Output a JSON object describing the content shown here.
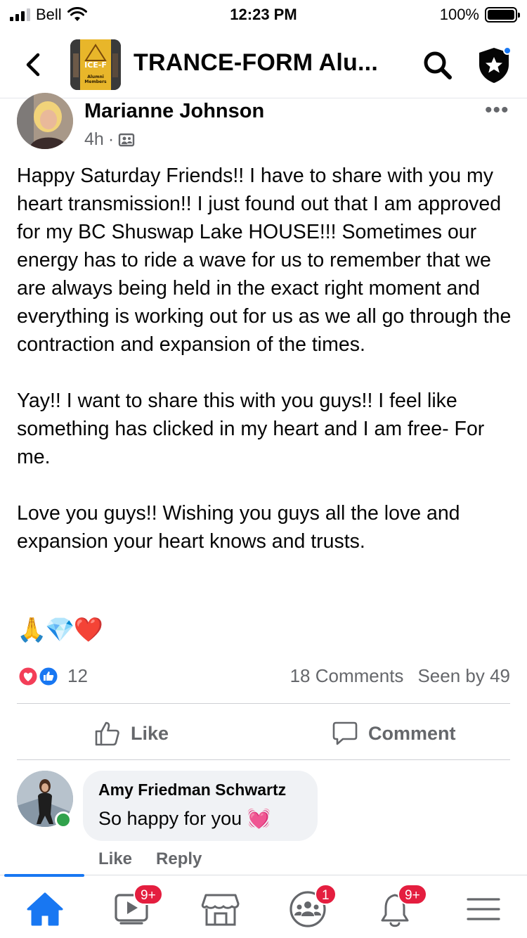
{
  "status_bar": {
    "carrier": "Bell",
    "time": "12:23 PM",
    "battery": "100%"
  },
  "header": {
    "title": "TRANCE-FORM Alu...",
    "thumb_text_top": "ICE-F",
    "thumb_text_bottom": "Alumni Members"
  },
  "post": {
    "author": "Marianne Johnson",
    "time": "4h",
    "separator": "·",
    "more": "•••",
    "body": "Happy Saturday Friends!! I have to share with you my heart transmission!! I just found out that I am approved for my BC Shuswap Lake HOUSE!!! Sometimes our energy has to ride a wave for us to remember that we are always being held in the exact right moment and everything is working out for us as we all go through the contraction and expansion of the times.\n\nYay!! I want to share this with you guys!! I feel like something has clicked in my heart and I am free- For me.\n\nLove you guys!! Wishing you guys all the love and expansion your heart knows and trusts.",
    "emojis": "🙏💎❤️",
    "reaction_count": "12",
    "comments": "18 Comments",
    "seen_by": "Seen by 49"
  },
  "actions": {
    "like": "Like",
    "comment": "Comment"
  },
  "comment": {
    "author": "Amy Friedman Schwartz",
    "text": "So happy for you 💓",
    "like": "Like",
    "reply": "Reply"
  },
  "tabbar": {
    "video_badge": "9+",
    "groups_badge": "1",
    "notifications_badge": "9+"
  },
  "colors": {
    "accent": "#1877f2",
    "badge": "#e41e3f",
    "muted": "#65676b",
    "online": "#31a24c"
  }
}
